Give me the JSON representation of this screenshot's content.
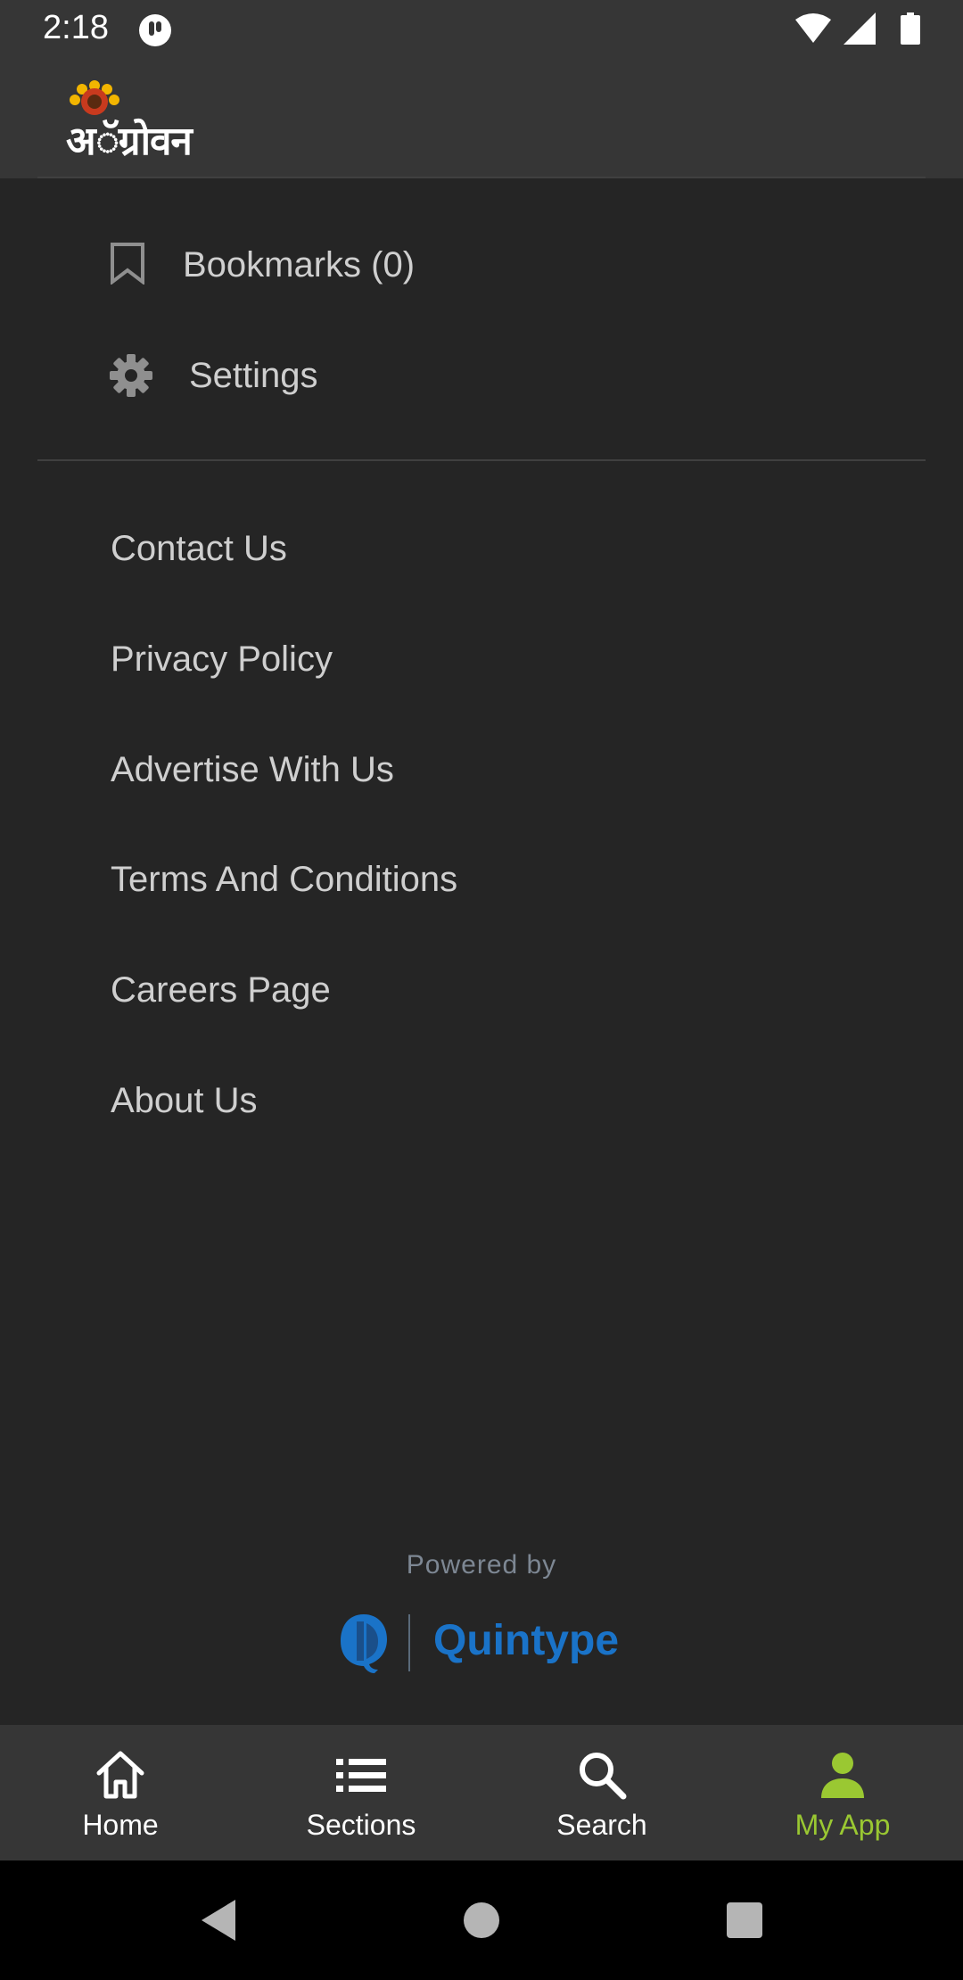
{
  "status_bar": {
    "time": "2:18"
  },
  "header": {
    "logo_text": "अॅग्रोवन"
  },
  "account_menu": {
    "bookmarks_label": "Bookmarks (0)",
    "settings_label": "Settings"
  },
  "links": [
    {
      "label": "Contact Us"
    },
    {
      "label": "Privacy Policy"
    },
    {
      "label": "Advertise With Us"
    },
    {
      "label": "Terms And Conditions"
    },
    {
      "label": "Careers Page"
    },
    {
      "label": "About Us"
    }
  ],
  "footer": {
    "powered_by": "Powered by",
    "brand": "Quintype"
  },
  "bottom_nav": {
    "items": [
      {
        "label": "Home",
        "icon": "home-icon"
      },
      {
        "label": "Sections",
        "icon": "list-icon"
      },
      {
        "label": "Search",
        "icon": "search-icon"
      },
      {
        "label": "My App",
        "icon": "person-icon",
        "active": true
      }
    ]
  },
  "colors": {
    "background": "#252525",
    "bar": "#363636",
    "accent": "#9ac832",
    "brand_blue": "#1a73c8"
  }
}
